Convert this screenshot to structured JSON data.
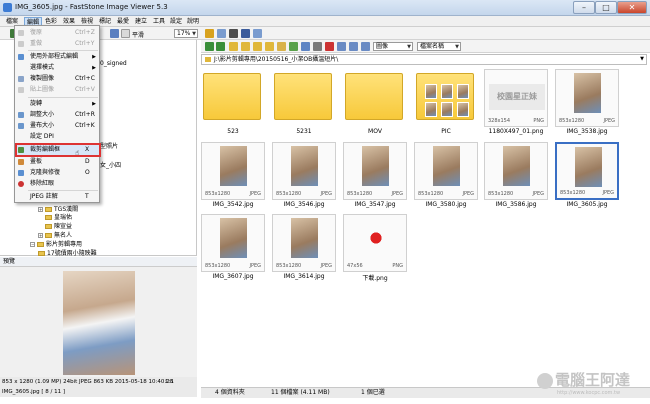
{
  "window": {
    "title": "IMG_3605.jpg - FastStone Image Viewer 5.3"
  },
  "menu": [
    "檔案",
    "編輯",
    "色彩",
    "效果",
    "檢視",
    "標記",
    "最愛",
    "建立",
    "工具",
    "設定",
    "說明"
  ],
  "toolbar": {
    "zoom_value": "17%",
    "smooth_label": "平滑",
    "sort_value": "檔案名稱",
    "view_value": "圖像"
  },
  "address": {
    "path": "J:\\影片剪輯專用\\20150516_小潔OB攝溫短片\\"
  },
  "tree": {
    "items": [
      {
        "label": "0_signed"
      },
      {
        "label": "型照片"
      },
      {
        "label": "女_小四"
      },
      {
        "label": "TGS漢關"
      },
      {
        "label": "皇瑞佑"
      },
      {
        "label": "陳宣益"
      },
      {
        "label": "無名人"
      },
      {
        "label": "影片剪輯專用"
      },
      {
        "label": "17號債兩小隨映難"
      }
    ]
  },
  "context_menu": {
    "items": [
      {
        "label": "復原",
        "shortcut": "Ctrl+Z",
        "disabled": true
      },
      {
        "label": "重做",
        "shortcut": "Ctrl+Y",
        "disabled": true
      },
      {
        "label": "使用外部程式編輯",
        "shortcut": "",
        "submenu": true
      },
      {
        "label": "選擇模式",
        "shortcut": "",
        "submenu": true
      },
      {
        "label": "複製圖像",
        "shortcut": "Ctrl+C"
      },
      {
        "label": "貼上圖像",
        "shortcut": "Ctrl+V",
        "disabled": true
      },
      {
        "label": "旋轉",
        "shortcut": "",
        "submenu": true
      },
      {
        "label": "調整大小",
        "shortcut": "Ctrl+R"
      },
      {
        "label": "畫布大小",
        "shortcut": "Ctrl+K"
      },
      {
        "label": "設定 DPI",
        "shortcut": ""
      },
      {
        "label": "裁剪編輯框",
        "shortcut": "X",
        "highlighted": true
      },
      {
        "label": "畫板",
        "shortcut": "D"
      },
      {
        "label": "克隆與修復",
        "shortcut": "O"
      },
      {
        "label": "移除紅眼",
        "shortcut": ""
      },
      {
        "label": "JPEG 註解",
        "shortcut": "T"
      }
    ]
  },
  "preview": {
    "header": "預覽",
    "status_line1": "853 x 1280 (1.09 MP)  24bit  JPEG  863 KB  2015-05-18 10:40:28",
    "zoom_label": "1:1",
    "status_line2": "IMG_3605.jpg [ 8 / 11 ]"
  },
  "thumbnails": [
    {
      "name": "523",
      "kind": "folder",
      "dims": "",
      "fmt": ""
    },
    {
      "name": "5231",
      "kind": "folder",
      "dims": "",
      "fmt": ""
    },
    {
      "name": "MOV",
      "kind": "folder",
      "dims": "",
      "fmt": ""
    },
    {
      "name": "PIC",
      "kind": "folder",
      "dims": "",
      "fmt": ""
    },
    {
      "name": "1180X497_01.png",
      "kind": "banner",
      "dims": "328x154",
      "fmt": "PNG"
    },
    {
      "name": "IMG_3538.jpg",
      "kind": "photo",
      "dims": "853x1280",
      "fmt": "JPEG"
    },
    {
      "name": "IMG_3542.jpg",
      "kind": "photo",
      "dims": "853x1280",
      "fmt": "JPEG"
    },
    {
      "name": "IMG_3546.jpg",
      "kind": "photo",
      "dims": "853x1280",
      "fmt": "JPEG"
    },
    {
      "name": "IMG_3547.jpg",
      "kind": "photo",
      "dims": "853x1280",
      "fmt": "JPEG"
    },
    {
      "name": "IMG_3580.jpg",
      "kind": "photo",
      "dims": "853x1280",
      "fmt": "JPEG"
    },
    {
      "name": "IMG_3586.jpg",
      "kind": "photo",
      "dims": "853x1280",
      "fmt": "JPEG"
    },
    {
      "name": "IMG_3605.jpg",
      "kind": "photo",
      "dims": "853x1280",
      "fmt": "JPEG",
      "selected": true
    },
    {
      "name": "IMG_3607.jpg",
      "kind": "photo",
      "dims": "853x1280",
      "fmt": "JPEG"
    },
    {
      "name": "IMG_3614.jpg",
      "kind": "photo",
      "dims": "853x1280",
      "fmt": "JPEG"
    },
    {
      "name": "下載.png",
      "kind": "icon",
      "dims": "47x56",
      "fmt": "PNG"
    }
  ],
  "status": {
    "folders": "4 個資料夾",
    "files": "11 個檔案 (4.11 MB)",
    "selected": "1 個已選"
  },
  "banner_text": "校園星正妹",
  "watermark": {
    "text": "電腦王阿達",
    "url": "http://www.kocpc.com.tw"
  },
  "colors": {
    "selection": "#3a6fc4",
    "highlight_outline": "#d33333",
    "folder": "#f7c93a"
  }
}
